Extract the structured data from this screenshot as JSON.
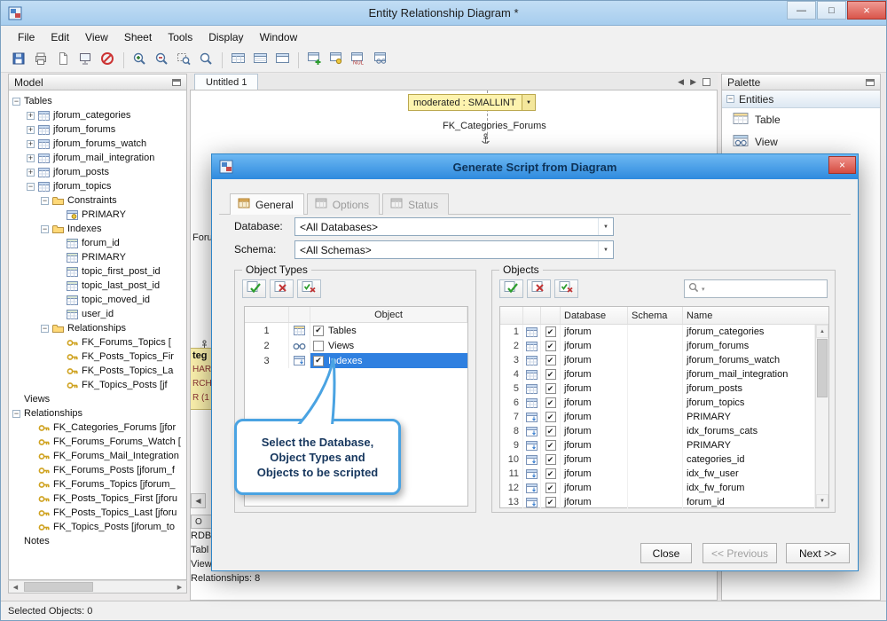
{
  "colors": {
    "selection": "#2f80e0",
    "dialog_titlebar": "#4aa0e8",
    "close_button": "#d9554a",
    "callout_border": "#4aa3e2",
    "callout_text": "#17375e",
    "note_yellow": "#fdf3ae"
  },
  "window": {
    "title": "Entity Relationship Diagram *"
  },
  "menu": {
    "items": [
      "File",
      "Edit",
      "View",
      "Sheet",
      "Tools",
      "Display",
      "Window"
    ]
  },
  "toolbar": {
    "buttons": [
      "save",
      "print",
      "new-sheet",
      "presentation",
      "cancel",
      "|",
      "zoom-in",
      "zoom-out",
      "zoom-region",
      "zoom",
      "|",
      "table-style-1",
      "table-style-2",
      "table-style-3",
      "|",
      "new-table",
      "table-key",
      "table-null",
      "table-view"
    ]
  },
  "model_panel": {
    "title": "Model",
    "tree": [
      {
        "label": "Tables",
        "depth": 0,
        "exp": "minus",
        "icon": "none"
      },
      {
        "label": "jforum_categories",
        "depth": 1,
        "exp": "plus",
        "icon": "table"
      },
      {
        "label": "jforum_forums",
        "depth": 1,
        "exp": "plus",
        "icon": "table"
      },
      {
        "label": "jforum_forums_watch",
        "depth": 1,
        "exp": "plus",
        "icon": "table"
      },
      {
        "label": "jforum_mail_integration",
        "depth": 1,
        "exp": "plus",
        "icon": "table"
      },
      {
        "label": "jforum_posts",
        "depth": 1,
        "exp": "plus",
        "icon": "table"
      },
      {
        "label": "jforum_topics",
        "depth": 1,
        "exp": "minus",
        "icon": "table"
      },
      {
        "label": "Constraints",
        "depth": 2,
        "exp": "minus",
        "icon": "folder"
      },
      {
        "label": "PRIMARY",
        "depth": 3,
        "exp": "none",
        "icon": "pk"
      },
      {
        "label": "Indexes",
        "depth": 2,
        "exp": "minus",
        "icon": "folder"
      },
      {
        "label": "forum_id",
        "depth": 3,
        "exp": "none",
        "icon": "index"
      },
      {
        "label": "PRIMARY",
        "depth": 3,
        "exp": "none",
        "icon": "index"
      },
      {
        "label": "topic_first_post_id",
        "depth": 3,
        "exp": "none",
        "icon": "index"
      },
      {
        "label": "topic_last_post_id",
        "depth": 3,
        "exp": "none",
        "icon": "index"
      },
      {
        "label": "topic_moved_id",
        "depth": 3,
        "exp": "none",
        "icon": "index"
      },
      {
        "label": "user_id",
        "depth": 3,
        "exp": "none",
        "icon": "index"
      },
      {
        "label": "Relationships",
        "depth": 2,
        "exp": "minus",
        "icon": "folder"
      },
      {
        "label": "FK_Forums_Topics [",
        "depth": 3,
        "exp": "none",
        "icon": "fk"
      },
      {
        "label": "FK_Posts_Topics_Fir",
        "depth": 3,
        "exp": "none",
        "icon": "fk"
      },
      {
        "label": "FK_Posts_Topics_La",
        "depth": 3,
        "exp": "none",
        "icon": "fk"
      },
      {
        "label": "FK_Topics_Posts [jf",
        "depth": 3,
        "exp": "none",
        "icon": "fk"
      },
      {
        "label": "Views",
        "depth": 0,
        "exp": "none",
        "icon": "none"
      },
      {
        "label": "Relationships",
        "depth": 0,
        "exp": "minus",
        "icon": "none"
      },
      {
        "label": "FK_Categories_Forums [jfor",
        "depth": 1,
        "exp": "none",
        "icon": "fk"
      },
      {
        "label": "FK_Forums_Forums_Watch [",
        "depth": 1,
        "exp": "none",
        "icon": "fk"
      },
      {
        "label": "FK_Forums_Mail_Integration",
        "depth": 1,
        "exp": "none",
        "icon": "fk"
      },
      {
        "label": "FK_Forums_Posts [jforum_f",
        "depth": 1,
        "exp": "none",
        "icon": "fk"
      },
      {
        "label": "FK_Forums_Topics [jforum_",
        "depth": 1,
        "exp": "none",
        "icon": "fk"
      },
      {
        "label": "FK_Posts_Topics_First [jforu",
        "depth": 1,
        "exp": "none",
        "icon": "fk"
      },
      {
        "label": "FK_Posts_Topics_Last [jforu",
        "depth": 1,
        "exp": "none",
        "icon": "fk"
      },
      {
        "label": "FK_Topics_Posts [jforum_to",
        "depth": 1,
        "exp": "none",
        "icon": "fk"
      },
      {
        "label": "Notes",
        "depth": 0,
        "exp": "none",
        "icon": "none"
      }
    ]
  },
  "canvas": {
    "tab": "Untitled 1",
    "column_box": "moderated : SMALLINT",
    "fk_label": "FK_Categories_Forums",
    "frag_top": "Foru",
    "yellow_lines": [
      "teg",
      "HAR",
      "RCHA",
      "R (1"
    ],
    "info_tab": "O",
    "info_lines": [
      "RDB",
      "Tabl",
      "View",
      "Relationships: 8"
    ]
  },
  "palette": {
    "title": "Palette",
    "section": "Entities",
    "items": [
      {
        "label": "Table",
        "icon": "table-big"
      },
      {
        "label": "View",
        "icon": "view-big"
      }
    ]
  },
  "dialog": {
    "title": "Generate Script from Diagram",
    "tabs": [
      {
        "label": "General",
        "active": true,
        "enabled": true
      },
      {
        "label": "Options",
        "active": false,
        "enabled": false
      },
      {
        "label": "Status",
        "active": false,
        "enabled": false
      }
    ],
    "fields": [
      {
        "label": "Database:",
        "value": "<All Databases>"
      },
      {
        "label": "Schema:",
        "value": "<All Schemas>"
      }
    ],
    "object_types": {
      "label": "Object Types",
      "column_header": "Object",
      "rows": [
        {
          "num": "1",
          "checked": true,
          "icon": "table2",
          "label": "Tables",
          "selected": false
        },
        {
          "num": "2",
          "checked": false,
          "icon": "glasses",
          "label": "Views",
          "selected": false
        },
        {
          "num": "3",
          "checked": true,
          "icon": "indexicon",
          "label": "Indexes",
          "selected": true
        }
      ]
    },
    "objects": {
      "label": "Objects",
      "headers": [
        "Database",
        "Schema",
        "Name"
      ],
      "search_value": "",
      "rows": [
        {
          "num": "1",
          "checked": true,
          "icon": "table",
          "database": "jforum",
          "schema": "",
          "name": "jforum_categories"
        },
        {
          "num": "2",
          "checked": true,
          "icon": "table",
          "database": "jforum",
          "schema": "",
          "name": "jforum_forums"
        },
        {
          "num": "3",
          "checked": true,
          "icon": "table",
          "database": "jforum",
          "schema": "",
          "name": "jforum_forums_watch"
        },
        {
          "num": "4",
          "checked": true,
          "icon": "table",
          "database": "jforum",
          "schema": "",
          "name": "jforum_mail_integration"
        },
        {
          "num": "5",
          "checked": true,
          "icon": "table",
          "database": "jforum",
          "schema": "",
          "name": "jforum_posts"
        },
        {
          "num": "6",
          "checked": true,
          "icon": "table",
          "database": "jforum",
          "schema": "",
          "name": "jforum_topics"
        },
        {
          "num": "7",
          "checked": true,
          "icon": "indexicon",
          "database": "jforum",
          "schema": "",
          "name": "PRIMARY"
        },
        {
          "num": "8",
          "checked": true,
          "icon": "indexicon",
          "database": "jforum",
          "schema": "",
          "name": "idx_forums_cats"
        },
        {
          "num": "9",
          "checked": true,
          "icon": "indexicon",
          "database": "jforum",
          "schema": "",
          "name": "PRIMARY"
        },
        {
          "num": "10",
          "checked": true,
          "icon": "indexicon",
          "database": "jforum",
          "schema": "",
          "name": "categories_id"
        },
        {
          "num": "11",
          "checked": true,
          "icon": "indexicon",
          "database": "jforum",
          "schema": "",
          "name": "idx_fw_user"
        },
        {
          "num": "12",
          "checked": true,
          "icon": "indexicon",
          "database": "jforum",
          "schema": "",
          "name": "idx_fw_forum"
        },
        {
          "num": "13",
          "checked": true,
          "icon": "indexicon",
          "database": "jforum",
          "schema": "",
          "name": "forum_id"
        }
      ]
    },
    "callout_lines": [
      "Select the Database,",
      "Object Types and",
      "Objects to be scripted"
    ],
    "buttons": [
      {
        "key": "close",
        "label": "Close",
        "enabled": true
      },
      {
        "key": "previous",
        "label": "<< Previous",
        "enabled": false
      },
      {
        "key": "next",
        "label": "Next >>",
        "enabled": true
      }
    ]
  },
  "status_bar": {
    "text": "Selected Objects: 0"
  }
}
